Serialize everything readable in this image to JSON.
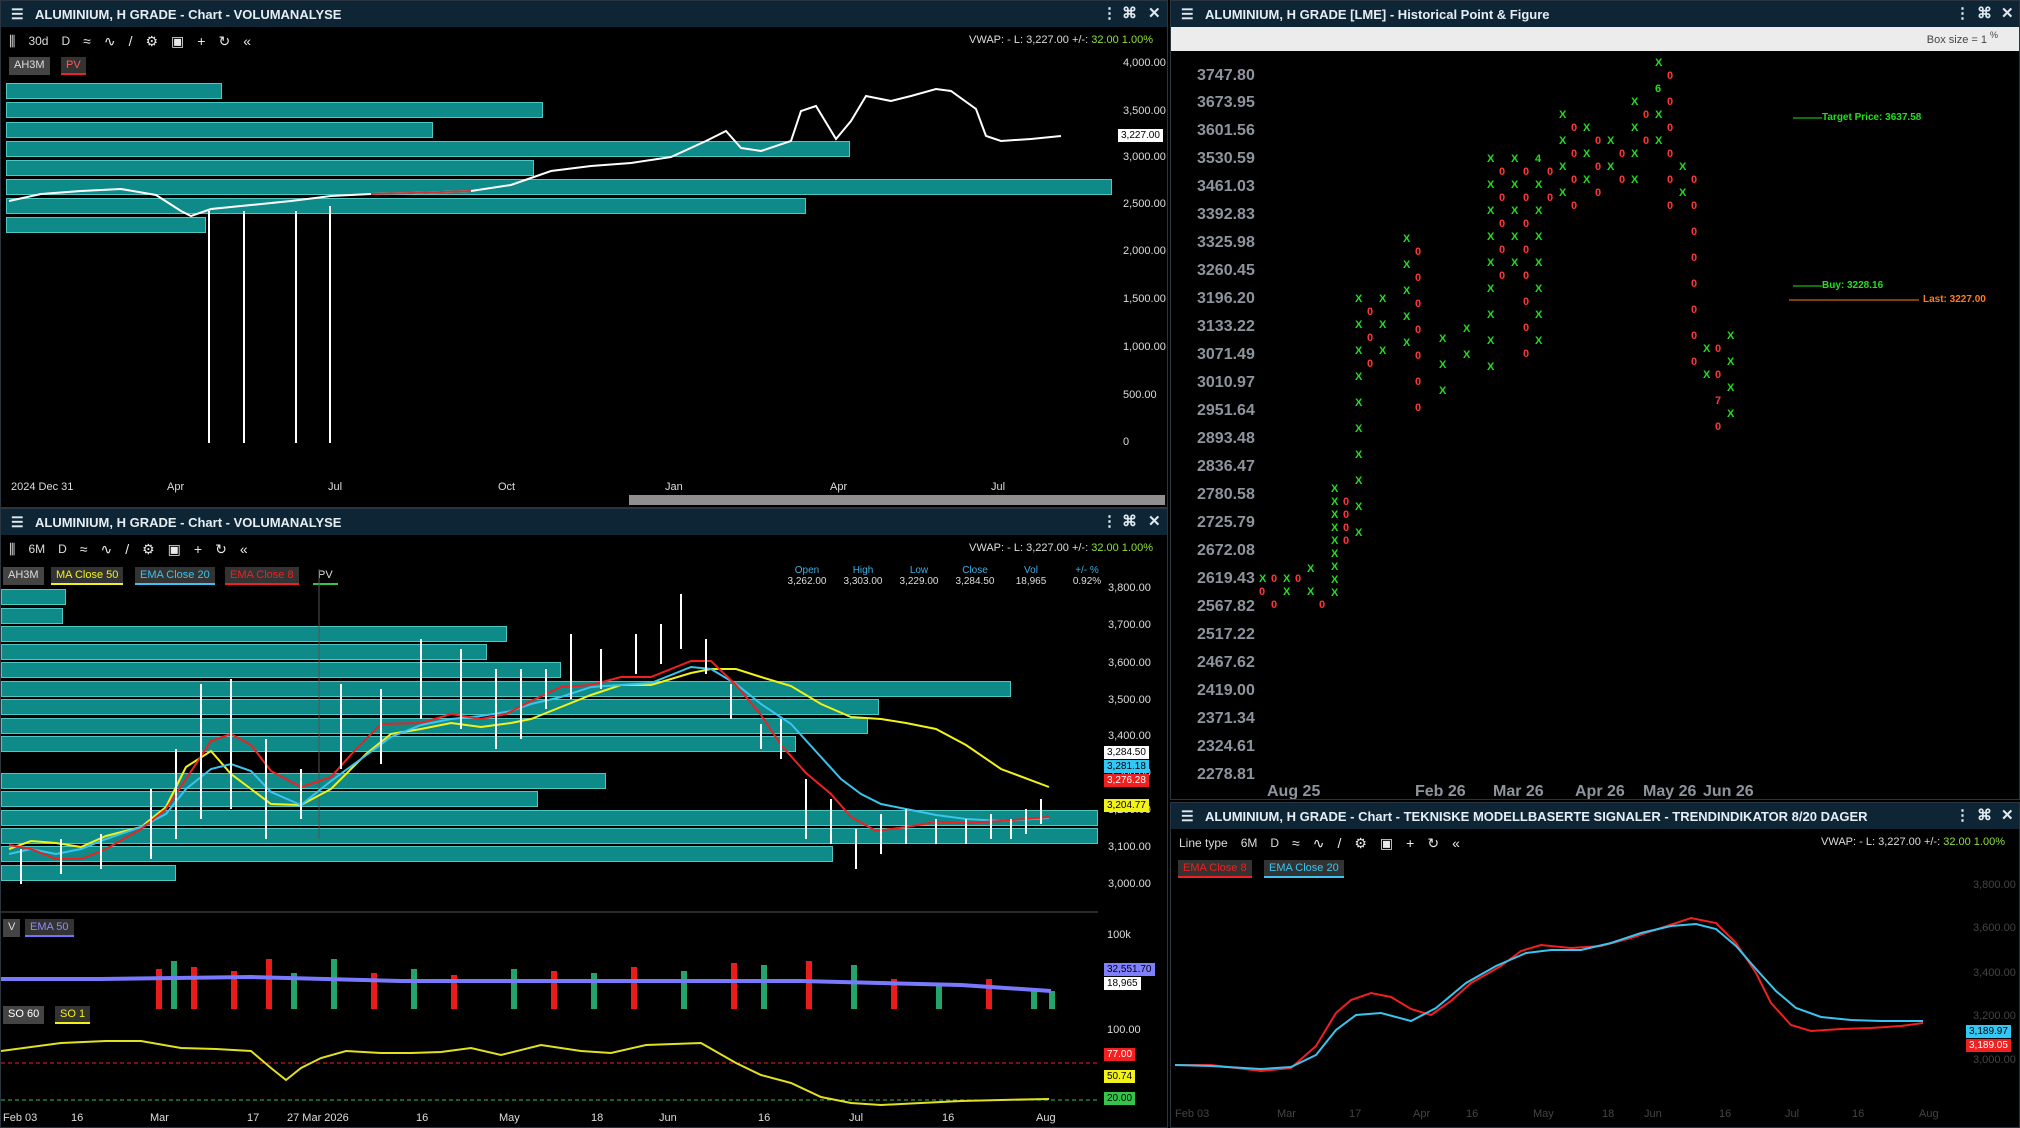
{
  "panels": {
    "top_left": {
      "title": "ALUMINIUM, H GRADE - Chart - VOLUMANALYSE",
      "toolbar": {
        "period": "30d",
        "interval": "D"
      },
      "vwap": "VWAP: -  L: 3,227.00  +/-:",
      "vwap_change": "32.00  1.00%",
      "tags": [
        "AH3M",
        "PV"
      ],
      "yticks": [
        "4,000.00",
        "3,500.00",
        "3,000.00",
        "2,500.00",
        "2,000.00",
        "1,500.00",
        "1,000.00",
        "500.00",
        "0"
      ],
      "xticks": [
        "2024 Dec 31",
        "Apr",
        "Jul",
        "Oct",
        "Jan",
        "Apr",
        "Jul"
      ],
      "last_price": "3,227.00"
    },
    "bottom_left": {
      "title": "ALUMINIUM, H GRADE - Chart - VOLUMANALYSE",
      "toolbar": {
        "period": "6M",
        "interval": "D"
      },
      "vwap": "VWAP: -  L: 3,227.00  +/-:",
      "vwap_change": "32.00  1.00%",
      "tags": [
        {
          "text": "AH3M",
          "color": "#666666"
        },
        {
          "text": "MA Close 50",
          "color": "#f2f21a"
        },
        {
          "text": "EMA Close 20",
          "color": "#3ac4ef"
        },
        {
          "text": "EMA Close 8",
          "color": "#ef2020"
        },
        {
          "text": "PV",
          "color": "#35c449"
        }
      ],
      "ohlc_headers": [
        "Open",
        "High",
        "Low",
        "Close",
        "Vol",
        "+/- %"
      ],
      "ohlc_values": [
        "3,262.00",
        "3,303.00",
        "3,229.00",
        "3,284.50",
        "18,965",
        "0.92%"
      ],
      "yticks": [
        "3,800.00",
        "3,700.00",
        "3,600.00",
        "3,500.00",
        "3,400.00",
        "3,300.00",
        "3,200.00",
        "3,100.00",
        "3,000.00"
      ],
      "price_labels": [
        {
          "text": "3,284.50",
          "color": "#ffffff"
        },
        {
          "text": "3,281.18",
          "color": "#33c7f5"
        },
        {
          "text": "3,276.28",
          "color": "#ef2020"
        },
        {
          "text": "3,204.77",
          "color": "#f2f21a"
        }
      ],
      "volume_tags": [
        "V",
        "EMA 50"
      ],
      "volume_ticks": [
        "100k"
      ],
      "volume_labels": [
        "32,551.70",
        "18,965"
      ],
      "so_tags": [
        "SO 60",
        "SO 1"
      ],
      "so_ticks": [
        "100.00",
        "77.00",
        "50.74",
        "20.00"
      ],
      "xticks": [
        "Feb 03",
        "16",
        "Mar",
        "17",
        "27 Mar 2026",
        "16",
        "May",
        "18",
        "Jun",
        "16",
        "Jul",
        "16",
        "Aug"
      ]
    },
    "top_right": {
      "title": "ALUMINIUM, H GRADE [LME] - Historical Point & Figure",
      "box_size": "Box size = 1",
      "box_size_unit": "%",
      "yticks": [
        "3747.80",
        "3673.95",
        "3601.56",
        "3530.59",
        "3461.03",
        "3392.83",
        "3325.98",
        "3260.45",
        "3196.20",
        "3133.22",
        "3071.49",
        "3010.97",
        "2951.64",
        "2893.48",
        "2836.47",
        "2780.58",
        "2725.79",
        "2672.08",
        "2619.43",
        "2567.82",
        "2517.22",
        "2467.62",
        "2419.00",
        "2371.34",
        "2324.61",
        "2278.81"
      ],
      "xticks": [
        "Aug 25",
        "Feb 26",
        "Mar 26",
        "Apr 26",
        "May 26",
        "Jun 26"
      ],
      "target_label": "Target Price: 3637.58",
      "buy_label": "Buy: 3228.16",
      "last_label": "Last: 3227.00"
    },
    "bottom_right": {
      "title": "ALUMINIUM, H GRADE - Chart - TEKNISKE MODELLBASERTE SIGNALER - TRENDINDIKATOR 8/20 DAGER",
      "toolbar": {
        "line_type": "Line type",
        "period": "6M",
        "interval": "D"
      },
      "vwap": "VWAP: -  L: 3,227.00  +/-:",
      "vwap_change": "32.00  1.00%",
      "tags": [
        {
          "text": "EMA Close 8",
          "color": "#ef2020"
        },
        {
          "text": "EMA Close 20",
          "color": "#3ac4ef"
        }
      ],
      "yticks": [
        "3,800.00",
        "3,600.00",
        "3,400.00",
        "3,200.00",
        "3,000.00"
      ],
      "price_labels": [
        {
          "text": "3,189.97",
          "color": "#33c7f5"
        },
        {
          "text": "3,189.05",
          "color": "#ef2020"
        }
      ],
      "xticks": [
        "Feb 03",
        "Mar",
        "17",
        "Apr",
        "16",
        "May",
        "18",
        "Jun",
        "16",
        "Jul",
        "16",
        "Aug"
      ]
    }
  },
  "chart_data": [
    {
      "type": "line",
      "title": "ALUMINIUM, H GRADE - Chart - VOLUMANALYSE",
      "xlabel": "",
      "ylabel": "",
      "x": [
        "2024-12-31",
        "2025-04-01",
        "2025-07-01",
        "2025-10-01",
        "2026-01-02",
        "2026-04-01",
        "2026-07-01",
        "2026-08-03"
      ],
      "series": [
        {
          "values": [
            2500,
            2380,
            2510,
            2560,
            2850,
            3450,
            3050,
            3227
          ]
        }
      ],
      "ylim": [
        0,
        4000
      ]
    },
    {
      "type": "line",
      "title": "ALUMINIUM, H GRADE - Chart - VOLUMANALYSE",
      "x": [
        "Feb 03",
        "Mar",
        "Apr",
        "May",
        "Jun",
        "Jul",
        "Aug"
      ],
      "series": [
        {
          "name": "MA Close 50",
          "values": [
            3050,
            3150,
            3330,
            3500,
            3570,
            3390,
            3270
          ]
        },
        {
          "name": "EMA Close 20",
          "values": [
            3050,
            3270,
            3400,
            3590,
            3700,
            3300,
            3281
          ]
        },
        {
          "name": "EMA Close 8",
          "values": [
            3100,
            3380,
            3460,
            3640,
            3700,
            3200,
            3276
          ]
        }
      ],
      "ylim": [
        3000,
        3800
      ]
    },
    {
      "type": "line",
      "title": "ALUMINIUM, H GRADE - Chart - TEKNISKE MODELLBASERTE SIGNALER - TRENDINDIKATOR 8/20 DAGER",
      "x": [
        "Feb 03",
        "Mar",
        "Apr",
        "May",
        "Jun",
        "Jul",
        "Aug"
      ],
      "series": [
        {
          "name": "EMA Close 8",
          "values": [
            3050,
            3200,
            3450,
            3600,
            3700,
            3100,
            3189
          ]
        },
        {
          "name": "EMA Close 20",
          "values": [
            3050,
            3160,
            3430,
            3570,
            3660,
            3200,
            3190
          ]
        }
      ],
      "ylim": [
        3000,
        3800
      ]
    }
  ]
}
